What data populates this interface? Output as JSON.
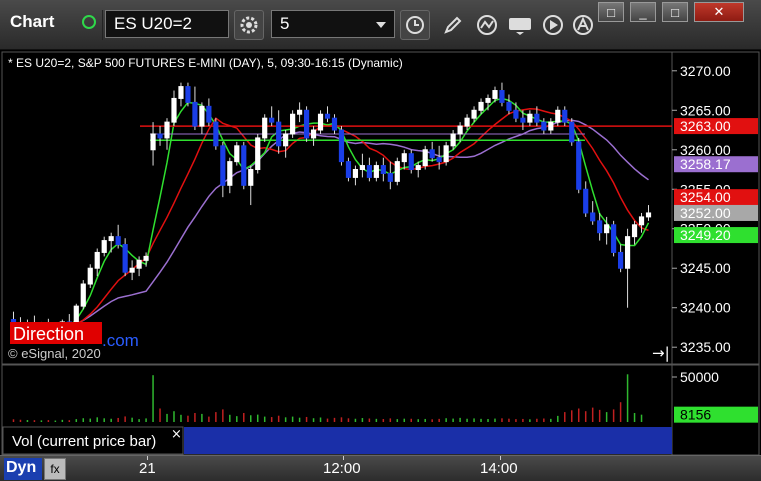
{
  "toolbar": {
    "title": "Chart",
    "symbol": "ES U20=2",
    "interval": "5"
  },
  "chart_header": "* ES U20=2, S&P 500 FUTURES E-MINI (DAY), 5, 09:30-16:15 (Dynamic)",
  "watermark": "© eSignal, 2020",
  "logo_text": "Direction",
  "logo_suffix": ".com",
  "y_ticks": [
    "3270.00",
    "3265.00",
    "3260.00",
    "3255.00",
    "3250.00",
    "3245.00",
    "3240.00",
    "3235.00"
  ],
  "price_tags": [
    {
      "value": "3263.00",
      "color": "#e11010"
    },
    {
      "value": "3258.17",
      "color": "#9b6fd0"
    },
    {
      "value": "3254.00",
      "color": "#e11010"
    },
    {
      "value": "3252.00",
      "color": "#a8a8a8"
    },
    {
      "value": "3249.20",
      "color": "#2fe02f"
    }
  ],
  "volume_ticks": [
    "50000"
  ],
  "volume_tag": "8156",
  "volume_panel_label": "Vol (current price bar)",
  "time_labels": [
    "21",
    "12:00",
    "14:00"
  ],
  "bottom_bar": {
    "dyn_label": "Dyn",
    "fx_label": "fx"
  },
  "colors": {
    "up_candle": "#ffffff",
    "down_candle": "#1a3ee8",
    "price_line": "#e11010",
    "ma_fast": "#2fe02f",
    "ma_slow": "#9b6fd0"
  },
  "chart_data": {
    "type": "candlestick",
    "ylim": [
      3233,
      3272
    ],
    "hlines": [
      3263.0,
      3249.2
    ],
    "candles": [
      [
        3238.5,
        3239.5,
        3236.8,
        3238.0
      ],
      [
        3238.0,
        3238.8,
        3237.2,
        3237.5
      ],
      [
        3237.5,
        3238.5,
        3236.5,
        3238.0
      ],
      [
        3238.0,
        3239.0,
        3237.0,
        3237.2
      ],
      [
        3237.2,
        3238.2,
        3236.5,
        3237.8
      ],
      [
        3237.8,
        3238.6,
        3236.8,
        3237.0
      ],
      [
        3237.0,
        3238.0,
        3236.0,
        3237.5
      ],
      [
        3237.5,
        3238.5,
        3236.5,
        3238.2
      ],
      [
        3238.2,
        3239.2,
        3237.5,
        3238.0
      ],
      [
        3238.0,
        3240.5,
        3237.8,
        3240.2
      ],
      [
        3240.2,
        3243.5,
        3239.8,
        3243.0
      ],
      [
        3243.0,
        3245.5,
        3242.5,
        3245.0
      ],
      [
        3245.0,
        3247.5,
        3244.0,
        3247.0
      ],
      [
        3247.0,
        3249.0,
        3246.5,
        3248.5
      ],
      [
        3248.5,
        3249.5,
        3247.0,
        3249.0
      ],
      [
        3249.0,
        3250.5,
        3247.5,
        3248.0
      ],
      [
        3248.0,
        3248.8,
        3244.0,
        3244.5
      ],
      [
        3244.5,
        3246.0,
        3243.5,
        3245.0
      ],
      [
        3245.0,
        3246.5,
        3244.0,
        3246.0
      ],
      [
        3246.0,
        3247.0,
        3245.2,
        3246.5
      ],
      [
        3260.0,
        3263.5,
        3258.0,
        3262.0
      ],
      [
        3262.0,
        3263.0,
        3260.5,
        3261.5
      ],
      [
        3261.5,
        3264.0,
        3260.0,
        3263.5
      ],
      [
        3263.5,
        3267.5,
        3263.0,
        3266.5
      ],
      [
        3266.5,
        3268.5,
        3265.5,
        3268.0
      ],
      [
        3268.0,
        3268.5,
        3265.5,
        3266.0
      ],
      [
        3266.0,
        3268.0,
        3262.5,
        3263.0
      ],
      [
        3263.0,
        3266.0,
        3262.0,
        3265.5
      ],
      [
        3265.5,
        3266.5,
        3263.0,
        3263.5
      ],
      [
        3263.5,
        3264.0,
        3260.0,
        3260.5
      ],
      [
        3260.5,
        3261.0,
        3254.0,
        3255.5
      ],
      [
        3255.5,
        3259.0,
        3254.5,
        3258.5
      ],
      [
        3258.5,
        3261.0,
        3258.0,
        3260.5
      ],
      [
        3260.5,
        3261.0,
        3255.0,
        3255.5
      ],
      [
        3255.5,
        3258.0,
        3253.0,
        3257.5
      ],
      [
        3257.5,
        3262.0,
        3257.0,
        3261.5
      ],
      [
        3261.5,
        3264.5,
        3261.0,
        3264.0
      ],
      [
        3264.0,
        3265.5,
        3263.0,
        3263.5
      ],
      [
        3263.5,
        3265.0,
        3259.5,
        3260.5
      ],
      [
        3260.5,
        3262.5,
        3259.0,
        3262.0
      ],
      [
        3262.0,
        3265.0,
        3261.5,
        3264.5
      ],
      [
        3264.5,
        3266.0,
        3263.5,
        3265.0
      ],
      [
        3265.0,
        3265.5,
        3261.0,
        3261.5
      ],
      [
        3261.5,
        3263.0,
        3260.5,
        3262.5
      ],
      [
        3262.5,
        3265.0,
        3262.0,
        3264.5
      ],
      [
        3264.5,
        3265.5,
        3263.5,
        3264.0
      ],
      [
        3264.0,
        3264.5,
        3262.0,
        3262.5
      ],
      [
        3262.5,
        3263.0,
        3258.0,
        3258.5
      ],
      [
        3258.5,
        3259.0,
        3256.0,
        3256.5
      ],
      [
        3256.5,
        3258.0,
        3255.5,
        3257.5
      ],
      [
        3257.5,
        3259.5,
        3256.5,
        3258.0
      ],
      [
        3258.0,
        3259.0,
        3256.0,
        3256.5
      ],
      [
        3256.5,
        3258.5,
        3256.0,
        3258.0
      ],
      [
        3258.0,
        3259.0,
        3256.0,
        3257.0
      ],
      [
        3257.0,
        3258.5,
        3255.0,
        3256.0
      ],
      [
        3256.0,
        3259.0,
        3255.5,
        3258.5
      ],
      [
        3258.5,
        3260.0,
        3257.5,
        3259.5
      ],
      [
        3259.5,
        3260.0,
        3257.0,
        3257.5
      ],
      [
        3257.5,
        3258.5,
        3256.5,
        3258.0
      ],
      [
        3258.0,
        3260.5,
        3257.5,
        3260.0
      ],
      [
        3260.0,
        3261.0,
        3258.5,
        3259.0
      ],
      [
        3259.0,
        3260.5,
        3257.5,
        3258.5
      ],
      [
        3258.5,
        3261.0,
        3258.0,
        3260.5
      ],
      [
        3260.5,
        3262.5,
        3260.0,
        3262.0
      ],
      [
        3262.0,
        3263.5,
        3261.0,
        3263.0
      ],
      [
        3263.0,
        3264.5,
        3262.5,
        3264.0
      ],
      [
        3264.0,
        3265.5,
        3263.5,
        3265.0
      ],
      [
        3265.0,
        3266.5,
        3264.5,
        3266.0
      ],
      [
        3266.0,
        3267.0,
        3265.0,
        3266.5
      ],
      [
        3266.5,
        3268.0,
        3266.0,
        3267.5
      ],
      [
        3267.5,
        3268.5,
        3265.5,
        3266.0
      ],
      [
        3266.0,
        3267.0,
        3264.5,
        3265.0
      ],
      [
        3265.0,
        3266.0,
        3263.5,
        3264.0
      ],
      [
        3264.0,
        3265.0,
        3262.5,
        3263.5
      ],
      [
        3263.5,
        3265.0,
        3263.0,
        3264.5
      ],
      [
        3264.5,
        3265.5,
        3263.0,
        3263.5
      ],
      [
        3263.5,
        3264.0,
        3262.0,
        3262.5
      ],
      [
        3262.5,
        3264.0,
        3262.0,
        3263.5
      ],
      [
        3263.5,
        3265.5,
        3263.0,
        3265.0
      ],
      [
        3265.0,
        3265.5,
        3263.0,
        3263.5
      ],
      [
        3263.5,
        3264.0,
        3260.5,
        3261.0
      ],
      [
        3261.0,
        3261.5,
        3254.5,
        3255.0
      ],
      [
        3255.0,
        3256.0,
        3251.5,
        3252.0
      ],
      [
        3252.0,
        3253.5,
        3250.5,
        3251.0
      ],
      [
        3251.0,
        3252.0,
        3248.5,
        3249.5
      ],
      [
        3249.5,
        3251.5,
        3248.0,
        3250.5
      ],
      [
        3250.5,
        3251.0,
        3246.5,
        3247.0
      ],
      [
        3247.0,
        3248.0,
        3244.5,
        3245.0
      ],
      [
        3245.0,
        3250.0,
        3240.0,
        3249.0
      ],
      [
        3249.0,
        3251.0,
        3248.0,
        3250.5
      ],
      [
        3250.5,
        3252.0,
        3249.5,
        3251.5
      ],
      [
        3251.5,
        3253.0,
        3251.0,
        3252.0
      ]
    ],
    "volume": [
      3000,
      2500,
      2200,
      2000,
      1800,
      2100,
      1600,
      2400,
      2000,
      3200,
      4200,
      3800,
      5200,
      4100,
      3600,
      4500,
      6200,
      4800,
      3200,
      4000,
      52000,
      15000,
      9000,
      12000,
      8000,
      7000,
      10000,
      9000,
      6000,
      11000,
      14000,
      8000,
      6500,
      10000,
      7500,
      8200,
      6000,
      5500,
      7000,
      5200,
      6000,
      4800,
      5600,
      4200,
      5000,
      3800,
      4600,
      5200,
      4100,
      3600,
      4400,
      3900,
      3500,
      3300,
      4000,
      3200,
      3700,
      3600,
      3100,
      3400,
      3000,
      3500,
      4200,
      3800,
      4600,
      3600,
      4000,
      3500,
      3300,
      3800,
      4100,
      3700,
      3200,
      3400,
      3000,
      3600,
      3900,
      3500,
      6800,
      11000,
      13000,
      15000,
      12000,
      16000,
      13500,
      11000,
      14000,
      22000,
      53000,
      10000,
      8156
    ]
  }
}
